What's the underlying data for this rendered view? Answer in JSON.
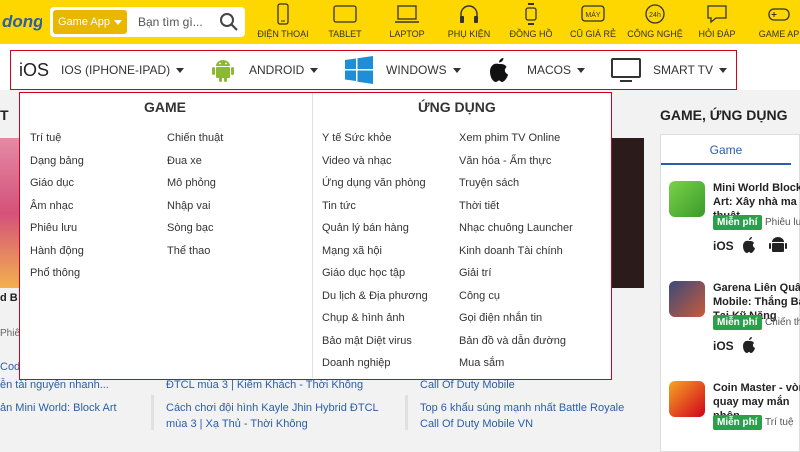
{
  "topbar": {
    "logo_text": "dong",
    "game_app_label": "Game App",
    "search_placeholder": "Bạn tìm gì...",
    "categories": [
      {
        "label": "ĐIỆN THOẠI",
        "icon": "phone-icon"
      },
      {
        "label": "TABLET",
        "icon": "tablet-icon"
      },
      {
        "label": "LAPTOP",
        "icon": "laptop-icon"
      },
      {
        "label": "PHỤ KIỆN",
        "icon": "headphones-icon"
      },
      {
        "label": "ĐỒNG HỒ",
        "icon": "watch-icon"
      },
      {
        "label": "CŨ GIÁ RẺ",
        "icon": "used-device-icon"
      },
      {
        "label": "CÔNG NGHỆ",
        "icon": "24h-icon"
      },
      {
        "label": "HỎI ĐÁP",
        "icon": "qa-icon"
      },
      {
        "label": "GAME AP",
        "icon": "gamepad-icon"
      }
    ]
  },
  "os_nav": {
    "ios_logo": "iOS",
    "items": [
      {
        "label": "IOS (IPHONE-IPAD)",
        "icon": "ios-text-icon"
      },
      {
        "label": "ANDROID",
        "icon": "android-icon"
      },
      {
        "label": "WINDOWS",
        "icon": "windows-icon"
      },
      {
        "label": "MACOS",
        "icon": "apple-icon"
      },
      {
        "label": "SMART TV",
        "icon": "tv-icon"
      }
    ]
  },
  "dropdown": {
    "game_heading": "GAME",
    "app_heading": "ỨNG DỤNG",
    "game_col1": [
      "Trí tuệ",
      "Dạng bảng",
      "Giáo dục",
      "Âm nhạc",
      "Phiêu lưu",
      "Hành động",
      "Phổ thông"
    ],
    "game_col2": [
      "Chiến thuật",
      "Đua xe",
      "Mô phỏng",
      "Nhập vai",
      "Sòng bạc",
      "Thể thao"
    ],
    "app_col1": [
      "Y tế Sức khỏe",
      "Video và nhạc",
      "Ứng dụng văn phòng",
      "Tin tức",
      "Quản lý bán hàng",
      "Mạng xã hội",
      "Giáo dục học tập",
      "Du lịch & Địa phương",
      "Chụp & hình ảnh",
      "Bảo mật Diệt virus",
      "Doanh nghiệp"
    ],
    "app_col2": [
      "Xem phim TV Online",
      "Văn hóa - Ẩm thực",
      "Truyện sách",
      "Thời tiết",
      "Nhạc chuông Launcher",
      "Kinh doanh Tài chính",
      "Giải trí",
      "Công cụ",
      "Gọi điện nhắn tin",
      "Bản đồ và dẫn đường",
      "Mua sắm"
    ]
  },
  "right_panel": {
    "title": "GAME, ỨNG DỤNG",
    "tab_label": "Game",
    "apps": [
      {
        "title": "Mini World Block Art: Xây nhà ma thuật",
        "badge": "Miễn phí",
        "genre": "Phiêu lưu",
        "platform": "iOS"
      },
      {
        "title": "Garena Liên Quân Mobile: Thắng Bại Tại Kỹ Năng",
        "badge": "Miễn phí",
        "genre": "Chiến thuật",
        "platform": "iOS"
      },
      {
        "title": "Coin Master - vòng quay may mắn nhộn",
        "badge": "Miễn phí",
        "genre": "Trí tuệ",
        "platform": "iOS"
      }
    ]
  },
  "background": {
    "left_heading": "T",
    "left_bd": "d B",
    "left_phie": "Phiê",
    "left_code": "Code",
    "left_link1": "ễn tài nguyên nhanh...",
    "left_link2": "ản Mini World: Block Art",
    "mid_link1": "ĐTCL mùa 3 | Kiếm Khách - Thời Không",
    "mid_link2": "Cách chơi đội hình Kayle Jhin Hybrid ĐTCL",
    "mid_link3": "mùa 3 | Xạ Thủ - Thời Không",
    "right_link1": "Call Of Duty Mobile",
    "right_link2": "Top 6 khẩu súng mạnh nhất Battle Royale",
    "right_link3": "Call Of Duty Mobile VN"
  },
  "colors": {
    "brand_yellow": "#fed700",
    "accent_red": "#d0021b",
    "link_blue": "#2a5ea8",
    "free_green": "#2aa04a"
  }
}
